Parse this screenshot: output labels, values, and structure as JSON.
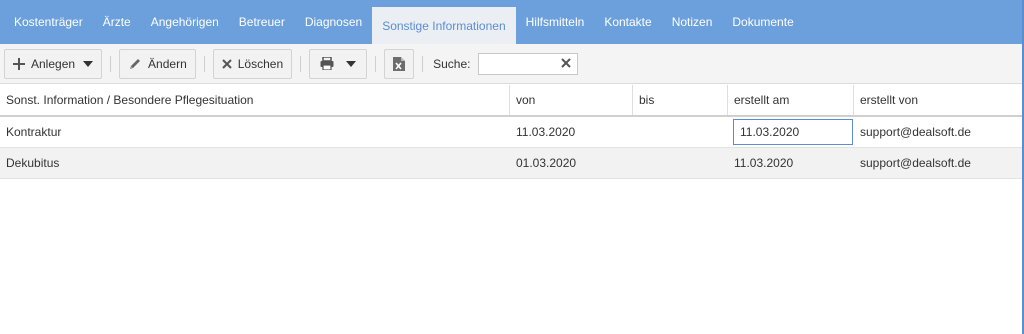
{
  "tabs": [
    {
      "label": "Kostenträger",
      "name": "tab-kostentraeger"
    },
    {
      "label": "Ärzte",
      "name": "tab-aerzte"
    },
    {
      "label": "Angehörigen",
      "name": "tab-angehoerigen"
    },
    {
      "label": "Betreuer",
      "name": "tab-betreuer"
    },
    {
      "label": "Diagnosen",
      "name": "tab-diagnosen"
    },
    {
      "label": "Sonstige Informationen",
      "name": "tab-sonstige-informationen",
      "active": true
    },
    {
      "label": "Hilfsmitteln",
      "name": "tab-hilfsmitteln"
    },
    {
      "label": "Kontakte",
      "name": "tab-kontakte"
    },
    {
      "label": "Notizen",
      "name": "tab-notizen"
    },
    {
      "label": "Dokumente",
      "name": "tab-dokumente"
    }
  ],
  "toolbar": {
    "anlegen_label": "Anlegen",
    "aendern_label": "Ändern",
    "loeschen_label": "Löschen",
    "search_label": "Suche:",
    "search_value": ""
  },
  "grid": {
    "columns": [
      "Sonst. Information / Besondere Pflegesituation",
      "von",
      "bis",
      "erstellt am",
      "erstellt von"
    ],
    "rows": [
      [
        "Kontraktur",
        "11.03.2020",
        "",
        "11.03.2020",
        "support@dealsoft.de"
      ],
      [
        "Dekubitus",
        "01.03.2020",
        "",
        "11.03.2020",
        "support@dealsoft.de"
      ]
    ]
  },
  "icons": {
    "add": "plus-icon",
    "dropdown": "caret-down-icon",
    "edit": "pencil-icon",
    "delete": "x-icon",
    "print": "printer-icon",
    "excel": "excel-icon",
    "clear": "clear-icon"
  },
  "colors": {
    "tabbar": "#6ba0dc",
    "active_tab_text": "#5b8ed0",
    "alt_row": "#f2f2f2"
  }
}
